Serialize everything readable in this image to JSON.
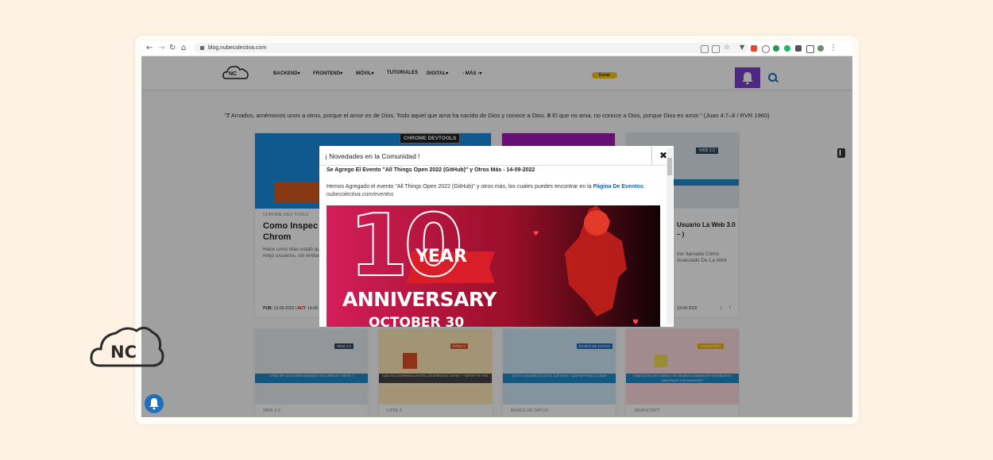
{
  "browser": {
    "url": "blog.nubecolectiva.com",
    "nav_icons": [
      "back-arrow-icon",
      "forward-arrow-icon",
      "reload-icon",
      "home-icon"
    ]
  },
  "site": {
    "logo_text": "NC",
    "menu": [
      {
        "label": "BACKEND",
        "has_dropdown": true
      },
      {
        "label": "FRONTEND",
        "has_dropdown": true
      },
      {
        "label": "MÓVIL",
        "has_dropdown": true
      },
      {
        "label": "TUTORIALES",
        "has_dropdown": false
      },
      {
        "label": "DIGITAL",
        "has_dropdown": true
      },
      {
        "label": "- MÁS -",
        "has_dropdown": true
      }
    ],
    "donate_label": "Donar",
    "verse_bold1": "7",
    "verse_part1": " Amados, amémonos unos a otros, porque el amor es de Dios. Todo aquel que ama ha nacido de Dios y conoce a Dios. ",
    "verse_bold2": "8",
    "verse_part2": " El que no ama, no conoce a Dios, porque Dios es amor.\" (Juan 4:7–8 / RVR 1960)",
    "accent_color": "#7b3fc8",
    "link_color": "#1a5fb4"
  },
  "cards_row1": [
    {
      "badge": "CHROME DEVTOOLS",
      "category": "CHROME DEV TOOLS",
      "title": "Como Inspec Google Chrom",
      "desc": "Hace unos días estab que necesitaba mejo usuarios, sin embarg",
      "pub_label": "PUB:",
      "pub_date": "13-09-2022",
      "act_label": "ACT:",
      "act_date": "14-09",
      "img_color": "#1a8be0"
    },
    {
      "category": "",
      "title": "",
      "img_color": "#a218b4"
    },
    {
      "badge": "WEB 3.0",
      "category": "",
      "title": "Usuario La Web 3.0 – )",
      "desc": "rior llamada Cómo Avanzado De La Web",
      "pub_date": "13-09-2022",
      "img_color": "#dfe6ec"
    }
  ],
  "cards_row2": [
    {
      "badge": "WEB 3.0",
      "category": "WEB 3.0",
      "strip_text": "CÓMO SER UN USUARIO AVANZADO DE LA WEB 3.0 - PARTE 1",
      "img_color": "#e8ecef"
    },
    {
      "badge": "HTML 5",
      "category": "HTML 5",
      "strip_text": "CUÁL ES LA DIFERENCIA ENTRE LOS ATRIBUTOS \"ASYNC\" Y \"DEFER\" EN HTML",
      "img_color": "#fde9b8"
    },
    {
      "badge": "BASES DE DATOS",
      "category": "BASES DE DATOS",
      "strip_text": "QUE ES UNA BASE DE DATOS, SUS TIPOS Y QUÉ EMPRESAS LA USAN",
      "img_color": "#cfe8f8"
    },
    {
      "badge": "JAVASCRIPT",
      "category": "JAVASCRIPT",
      "strip_text": "CÓMO DETECTAR CUANDO LOS USUARIOS CAMBIAN DE PESTAÑA EN EL NAVEGADOR CON JAVASCRIPT",
      "img_color": "#fcd9df"
    }
  ],
  "modal": {
    "title": "¡ Novedades en la Comunidad !",
    "close_glyph": "✖",
    "subtitle": "Se Agrego El Evento \"All Things Open 2022 (GitHub)\" y Otros Más - 14-09-2022",
    "body_text": "Hemos Agregado el evento \"All Things Open 2022 (GitHub)\" y otros más, los cuales puedes encontrar en la ",
    "body_link": "Página De Eventos",
    "body_after": ": ",
    "body_italic": "nubecolectiva.com/eventos",
    "poster": {
      "number": "10",
      "year_label": "YEAR",
      "anniversary_label": "ANNIVERSARY",
      "date_label": "OCTOBER 30"
    }
  },
  "floating": {
    "logo_text": "NC"
  }
}
